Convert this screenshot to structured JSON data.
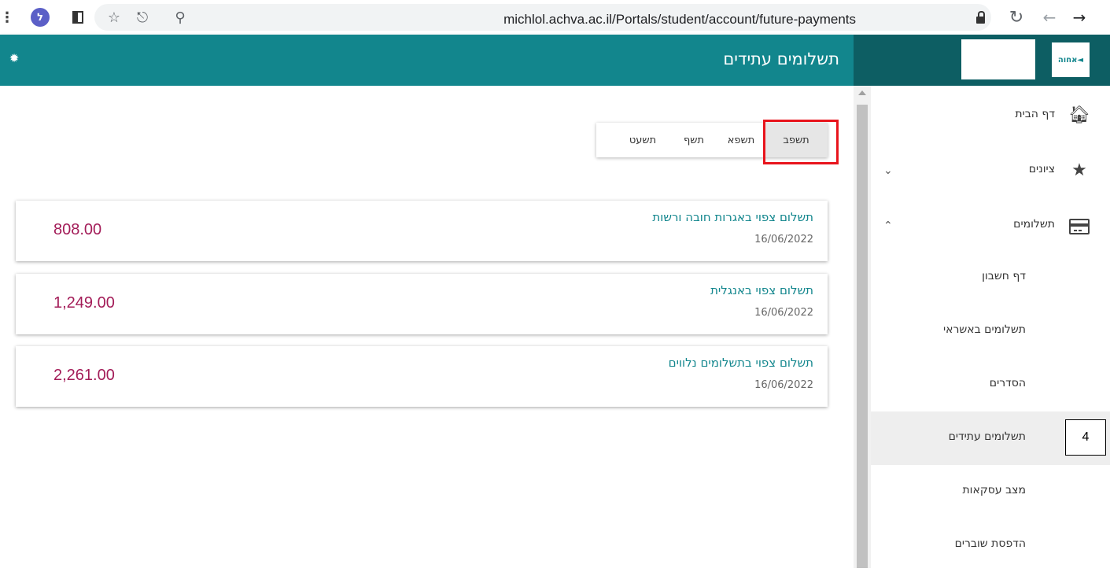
{
  "browser": {
    "url": "michlol.achva.ac.il/Portals/student/account/future-payments",
    "extension_letter": "ל"
  },
  "header": {
    "title": "תשלומים עתידים",
    "logo_text": "אחוה◄",
    "accent_color": "#12868d",
    "side_color": "#0d5e63"
  },
  "tabs": [
    {
      "label": "תשפב",
      "active": true
    },
    {
      "label": "תשפא",
      "active": false
    },
    {
      "label": "תשף",
      "active": false
    },
    {
      "label": "תשעט",
      "active": false
    }
  ],
  "payments": [
    {
      "title": "תשלום צפוי באגרות חובה ורשות",
      "date": "16/06/2022",
      "amount": "808.00"
    },
    {
      "title": "תשלום צפוי באנגלית",
      "date": "16/06/2022",
      "amount": "1,249.00"
    },
    {
      "title": "תשלום צפוי בתשלומים נלווים",
      "date": "16/06/2022",
      "amount": "2,261.00"
    }
  ],
  "sidebar": {
    "items": [
      {
        "label": "דף הבית",
        "icon": "home-icon"
      },
      {
        "label": "ציונים",
        "icon": "star-icon",
        "expanded": false
      },
      {
        "label": "תשלומים",
        "icon": "credit-card-icon",
        "expanded": true
      }
    ],
    "sub_items": [
      {
        "label": "דף חשבון",
        "active": false
      },
      {
        "label": "תשלומים באשראי",
        "active": false
      },
      {
        "label": "הסדרים",
        "active": false
      },
      {
        "label": "תשלומים עתידים",
        "active": true
      },
      {
        "label": "מצב עסקאות",
        "active": false
      },
      {
        "label": "הדפסת שוברים",
        "active": false
      }
    ]
  },
  "annotation": {
    "label": "4"
  }
}
